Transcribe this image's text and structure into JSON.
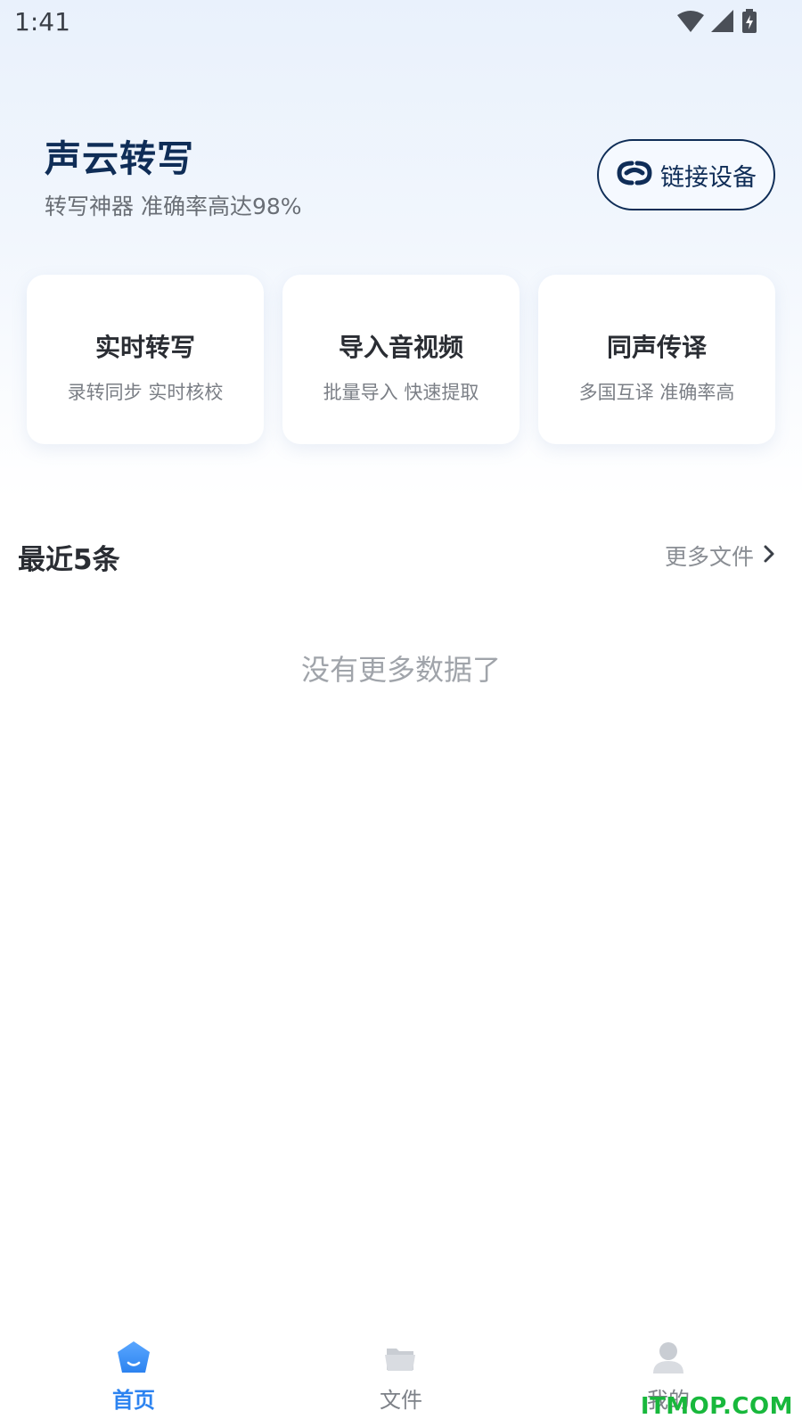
{
  "status_bar": {
    "time": "1:41"
  },
  "header": {
    "title": "声云转写",
    "subtitle": "转写神器 准确率高达98%",
    "connect_button": "链接设备"
  },
  "feature_cards": [
    {
      "title": "实时转写",
      "desc": "录转同步 实时核校"
    },
    {
      "title": "导入音视频",
      "desc": "批量导入 快速提取"
    },
    {
      "title": "同声传译",
      "desc": "多国互译 准确率高"
    }
  ],
  "recent": {
    "title": "最近5条",
    "more_link": "更多文件",
    "empty_text": "没有更多数据了"
  },
  "tabbar": {
    "items": [
      {
        "label": "首页",
        "icon": "home-icon",
        "active": true
      },
      {
        "label": "文件",
        "icon": "folder-icon",
        "active": false
      },
      {
        "label": "我的",
        "icon": "user-icon",
        "active": false
      }
    ]
  },
  "watermark": "ITMOP.COM",
  "colors": {
    "brand_navy": "#0f2d57",
    "accent_blue": "#2c83f0",
    "watermark_green": "#18b83c"
  }
}
